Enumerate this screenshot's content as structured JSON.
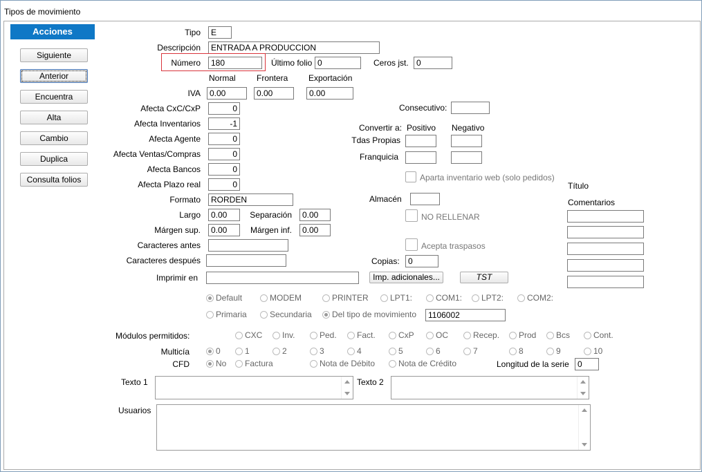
{
  "window_title": "Tipos de movimiento",
  "actions": {
    "header": "Acciones",
    "buttons": [
      "Siguiente",
      "Anterior",
      "Encuentra",
      "Alta",
      "Cambio",
      "Duplica",
      "Consulta folios"
    ]
  },
  "form": {
    "tipo_label": "Tipo",
    "tipo_value": "E",
    "descripcion_label": "Descripción",
    "descripcion_value": "ENTRADA A PRODUCCION",
    "numero_label": "Número",
    "numero_value": "180",
    "ultimo_folio_label": "Último folio",
    "ultimo_folio_value": "0",
    "ceros_label": "Ceros jst.",
    "ceros_value": "0",
    "normal_label": "Normal",
    "frontera_label": "Frontera",
    "exportacion_label": "Exportación",
    "iva_label": "IVA",
    "iva_normal": "0.00",
    "iva_frontera": "0.00",
    "iva_exportacion": "0.00",
    "afecta_cxc_label": "Afecta  CxC/CxP",
    "afecta_cxc_value": "0",
    "afecta_inv_label": "Afecta  Inventarios",
    "afecta_inv_value": "-1",
    "afecta_agente_label": "Afecta  Agente",
    "afecta_agente_value": "0",
    "afecta_ventas_label": "Afecta  Ventas/Compras",
    "afecta_ventas_value": "0",
    "afecta_bancos_label": "Afecta  Bancos",
    "afecta_bancos_value": "0",
    "afecta_plazo_label": "Afecta  Plazo real",
    "afecta_plazo_value": "0",
    "formato_label": "Formato",
    "formato_value": "RORDEN",
    "largo_label": "Largo",
    "largo_value": "0.00",
    "separacion_label": "Separación",
    "separacion_value": "0.00",
    "margen_sup_label": "Márgen sup.",
    "margen_sup_value": "0.00",
    "margen_inf_label": "Márgen inf.",
    "margen_inf_value": "0.00",
    "car_antes_label": "Caracteres antes",
    "car_antes_value": "",
    "car_despues_label": "Caracteres después",
    "car_despues_value": "",
    "imprimir_label": "Imprimir en",
    "imprimir_value": "",
    "consecutivo_label": "Consecutivo:",
    "consecutivo_value": "",
    "convertir_label": "Convertir a:",
    "positivo_label": "Positivo",
    "negativo_label": "Negativo",
    "tdas_label": "Tdas Propias",
    "franquicia_label": "Franquicia",
    "aparta_label": "Aparta inventario web (solo pedidos)",
    "almacen_label": "Almacén",
    "almacen_value": "",
    "no_rellenar_label": "NO RELLENAR",
    "acepta_label": "Acepta traspasos",
    "copias_label": "Copias:",
    "copias_value": "0",
    "imp_adicionales": "Imp. adicionales...",
    "tst": "TST",
    "titulo_label": "Título",
    "comentarios_label": "Comentarios",
    "port_options": [
      "Default",
      "MODEM",
      "PRINTER",
      "LPT1:",
      "COM1:",
      "LPT2:",
      "COM2:"
    ],
    "serie_options": [
      "Primaria",
      "Secundaria",
      "Del tipo de movimiento"
    ],
    "serie_value": "1106002",
    "modulos_label": "Módulos permitidos:",
    "modulos": [
      "CXC",
      "Inv.",
      "Ped.",
      "Fact.",
      "CxP",
      "OC",
      "Recep.",
      "Prod",
      "Bcs",
      "Cont."
    ],
    "multicia_label": "Multicía",
    "multicia": [
      "0",
      "1",
      "2",
      "3",
      "4",
      "5",
      "6",
      "7",
      "8",
      "9",
      "10"
    ],
    "cfd_label": "CFD",
    "cfd_options": [
      "No",
      "Factura",
      "Nota de Débito",
      "Nota de Crédito"
    ],
    "longitud_label": "Longitud de la serie",
    "longitud_value": "0",
    "texto1_label": "Texto 1",
    "texto2_label": "Texto 2",
    "usuarios_label": "Usuarios"
  }
}
